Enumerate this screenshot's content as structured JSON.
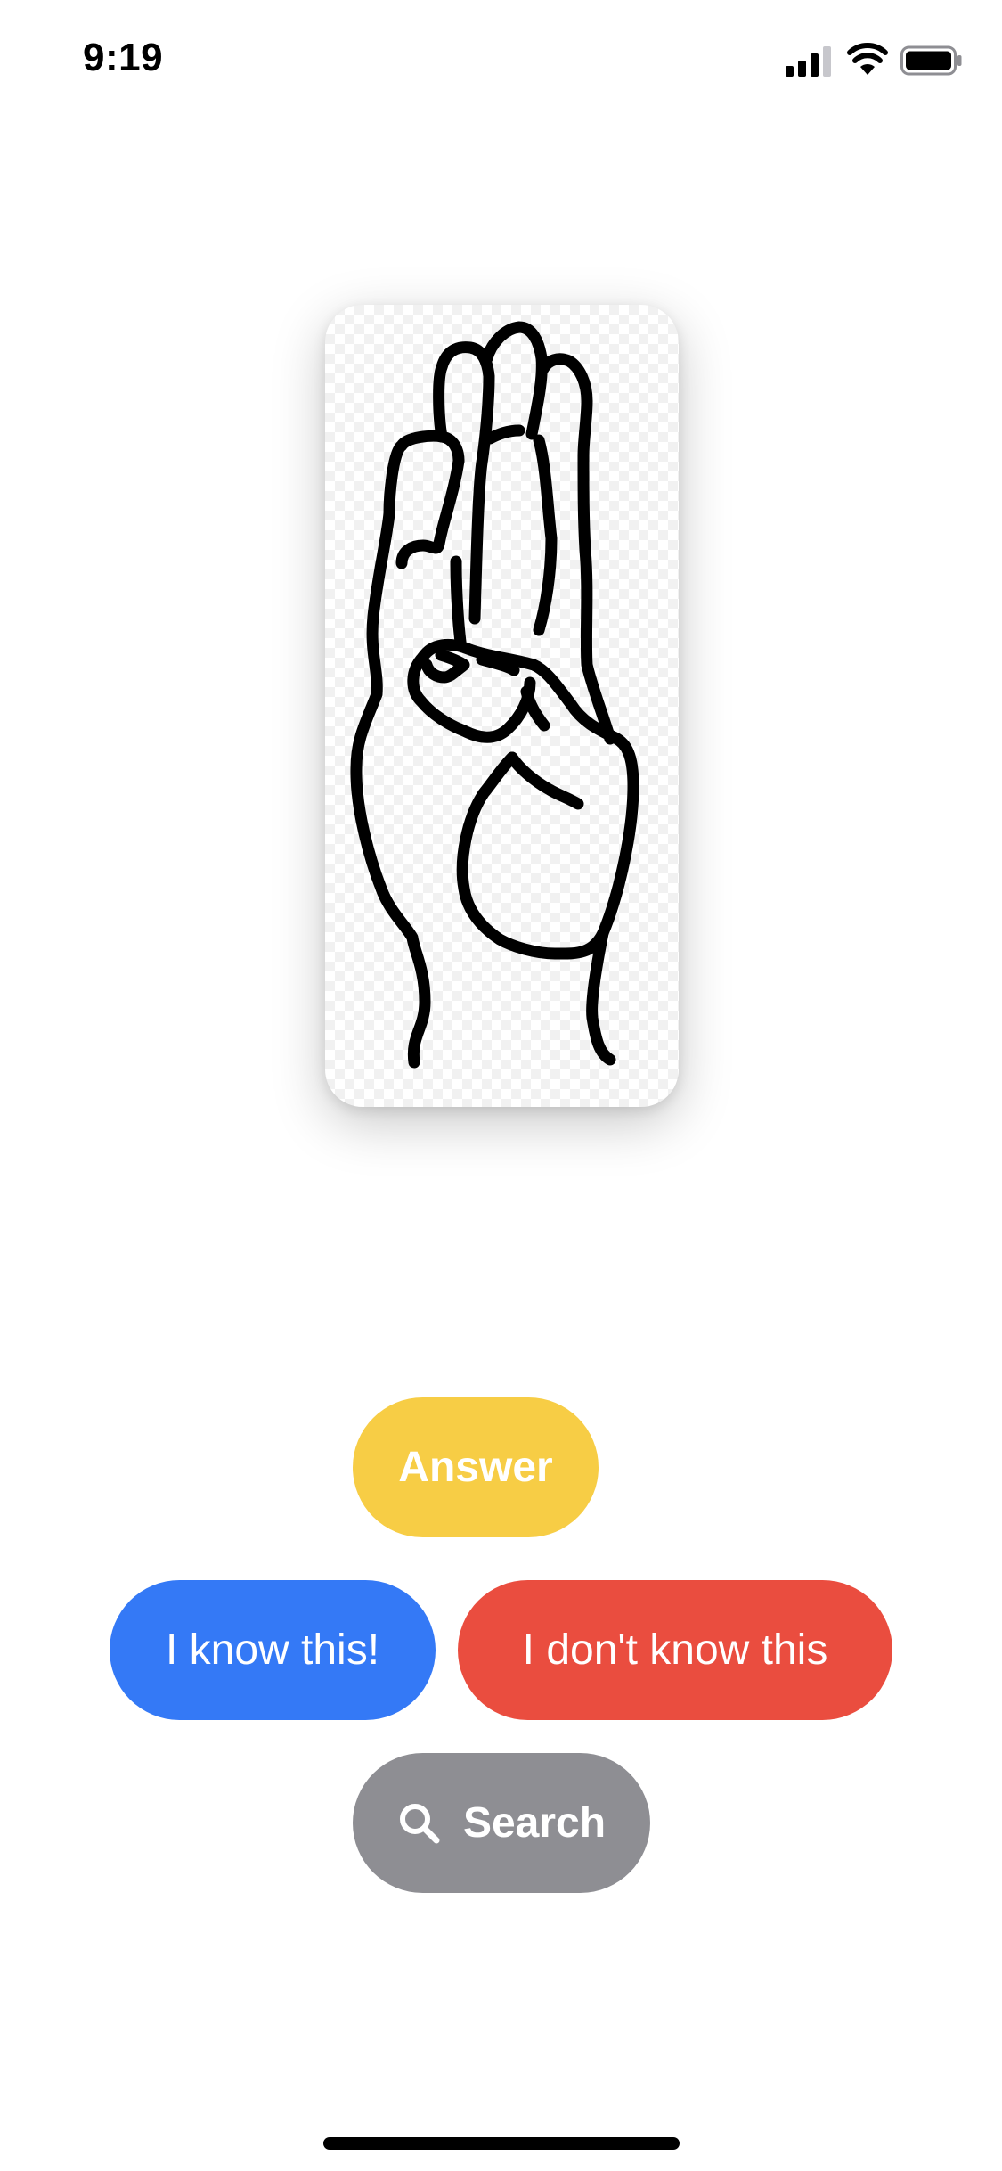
{
  "status_bar": {
    "time": "9:19"
  },
  "card": {
    "image_subject": "hand-sign-illustration"
  },
  "buttons": {
    "answer_label": "Answer",
    "know_label": "I know this!",
    "dont_know_label": "I don't know this",
    "search_label": "Search"
  },
  "icons": {
    "signal": "cellular-signal-icon",
    "wifi": "wifi-icon",
    "battery": "battery-icon",
    "search": "search-icon"
  },
  "colors": {
    "answer": "#f7cd45",
    "know": "#3479f6",
    "dont_know": "#ea4d3f",
    "search": "#8e8e93"
  }
}
